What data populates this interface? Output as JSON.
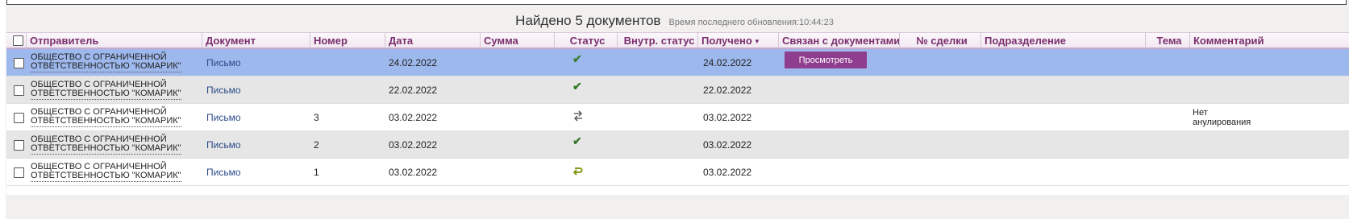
{
  "summary": {
    "title": "Найдено 5 документов",
    "updated": "Время последнего обновления:10:44:23"
  },
  "columns": {
    "sender": "Отправитель",
    "document": "Документ",
    "number": "Номер",
    "date": "Дата",
    "sum": "Сумма",
    "status": "Статус",
    "internal_status": "Внутр. статус",
    "received": "Получено",
    "linked": "Связан с документами",
    "deal": "№ сделки",
    "department": "Подразделение",
    "topic": "Тема",
    "comment": "Комментарий"
  },
  "rows": [
    {
      "sender1": "ОБЩЕСТВО С ОГРАНИЧЕННОЙ",
      "sender2": "ОТВЕТСТВЕННОСТЬЮ \"КОМАРИК\"",
      "document": "Письмо",
      "number": "",
      "date": "24.02.2022",
      "status_icon": "check-icon",
      "received": "24.02.2022",
      "linked_button": "Просмотреть",
      "comment": ""
    },
    {
      "sender1": "ОБЩЕСТВО С ОГРАНИЧЕННОЙ",
      "sender2": "ОТВЕТСТВЕННОСТЬЮ \"КОМАРИК\"",
      "document": "Письмо",
      "number": "",
      "date": "22.02.2022",
      "status_icon": "check-icon",
      "received": "22.02.2022",
      "comment": ""
    },
    {
      "sender1": "ОБЩЕСТВО С ОГРАНИЧЕННОЙ",
      "sender2": "ОТВЕТСТВЕННОСТЬЮ \"КОМАРИК\"",
      "document": "Письмо",
      "number": "3",
      "date": "03.02.2022",
      "status_icon": "exchange-icon",
      "received": "03.02.2022",
      "comment": "Нет анулирования"
    },
    {
      "sender1": "ОБЩЕСТВО С ОГРАНИЧЕННОЙ",
      "sender2": "ОТВЕТСТВЕННОСТЬЮ \"КОМАРИК\"",
      "document": "Письмо",
      "number": "2",
      "date": "03.02.2022",
      "status_icon": "check-icon",
      "received": "03.02.2022",
      "comment": ""
    },
    {
      "sender1": "ОБЩЕСТВО С ОГРАНИЧЕННОЙ",
      "sender2": "ОТВЕТСТВЕННОСТЬЮ \"КОМАРИК\"",
      "document": "Письмо",
      "number": "1",
      "date": "03.02.2022",
      "status_icon": "return-arrow-icon",
      "received": "03.02.2022",
      "comment": ""
    }
  ],
  "colors": {
    "header_text": "#7a2e6e",
    "selected_row": "#9db8ec",
    "button": "#8f3d8f",
    "check": "#3c7a2f",
    "return_arrow": "#8a9a1a"
  }
}
